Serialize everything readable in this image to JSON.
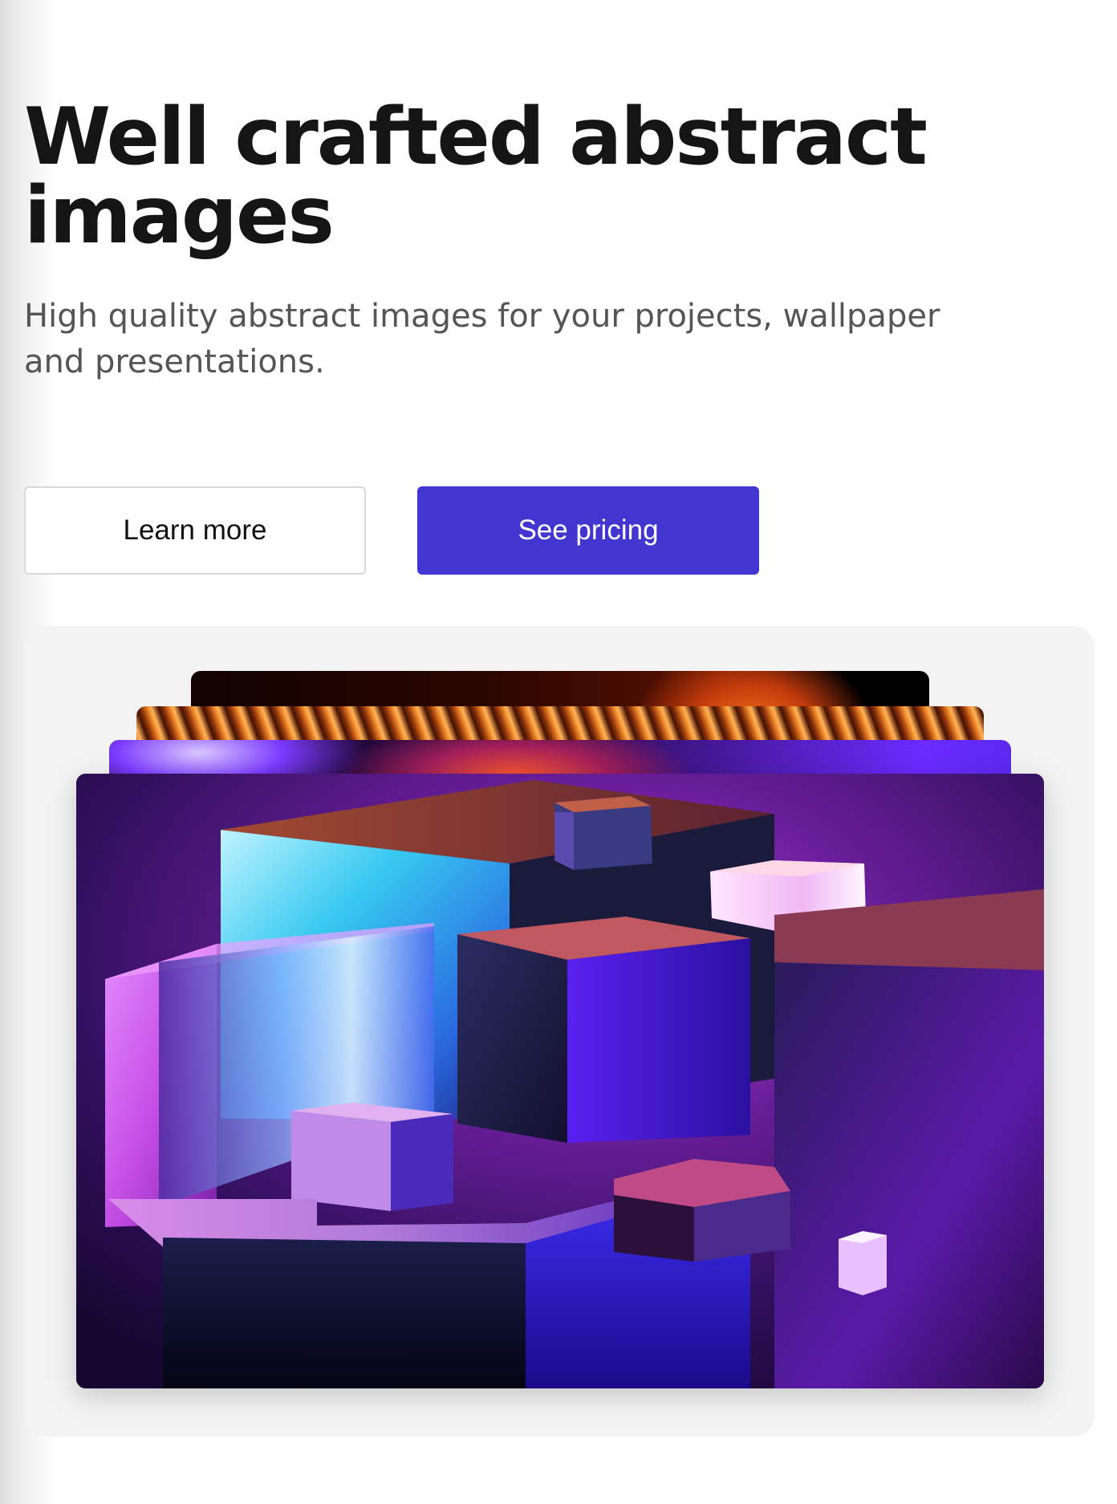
{
  "hero": {
    "title": "Well crafted abstract images",
    "subtitle": "High quality abstract images for your projects, wallpaper and presentations."
  },
  "actions": {
    "learn_more_label": "Learn more",
    "see_pricing_label": "See pricing"
  },
  "colors": {
    "primary": "#4335cf",
    "title": "#151515",
    "subtitle": "#555555",
    "gallery_background": "#f3f3f3"
  }
}
